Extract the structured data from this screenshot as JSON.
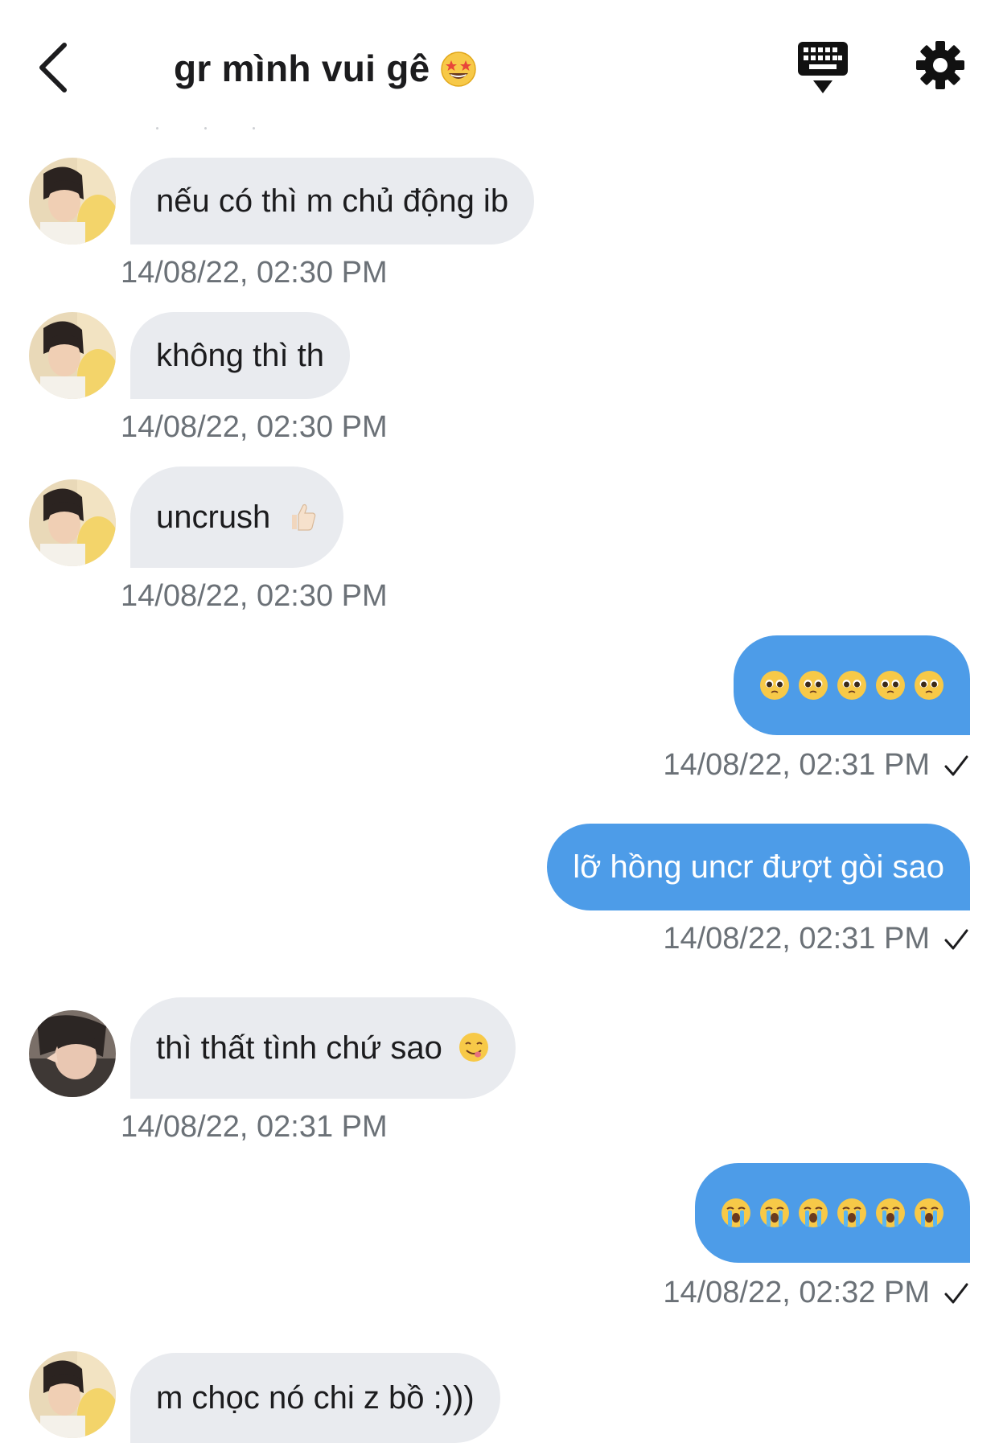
{
  "header": {
    "title": "gr mình vui gê",
    "title_emoji": "star-struck-emoji"
  },
  "messages": [
    {
      "side": "in",
      "text": "nếu có thì m chủ động ib",
      "time": "14/08/22, 02:30 PM"
    },
    {
      "side": "in",
      "text": "không thì th",
      "time": "14/08/22, 02:30 PM"
    },
    {
      "side": "in",
      "text": "uncrush",
      "emoji": "thumbs-up-emoji",
      "time": "14/08/22, 02:30 PM"
    },
    {
      "side": "out",
      "emojis": [
        "pleading-face-emoji",
        "pleading-face-emoji",
        "pleading-face-emoji",
        "pleading-face-emoji",
        "pleading-face-emoji"
      ],
      "time": "14/08/22, 02:31 PM",
      "status": "sent"
    },
    {
      "side": "out",
      "text": "lỡ hồng uncr đượt gòi sao",
      "time": "14/08/22, 02:31 PM",
      "status": "sent"
    },
    {
      "side": "in",
      "text": "thì thất tình chứ sao",
      "emoji": "face-savoring-food-emoji",
      "time": "14/08/22, 02:31 PM"
    },
    {
      "side": "out",
      "emojis": [
        "loudly-crying-face-emoji",
        "loudly-crying-face-emoji",
        "loudly-crying-face-emoji",
        "loudly-crying-face-emoji",
        "loudly-crying-face-emoji",
        "loudly-crying-face-emoji"
      ],
      "time": "14/08/22, 02:32 PM",
      "status": "sent"
    },
    {
      "side": "in",
      "text": "m chọc nó chi z bồ :)))"
    }
  ],
  "colors": {
    "incoming_bubble": "#e9ebef",
    "outgoing_bubble": "#4d9ce8",
    "timestamp": "#6b7177"
  }
}
